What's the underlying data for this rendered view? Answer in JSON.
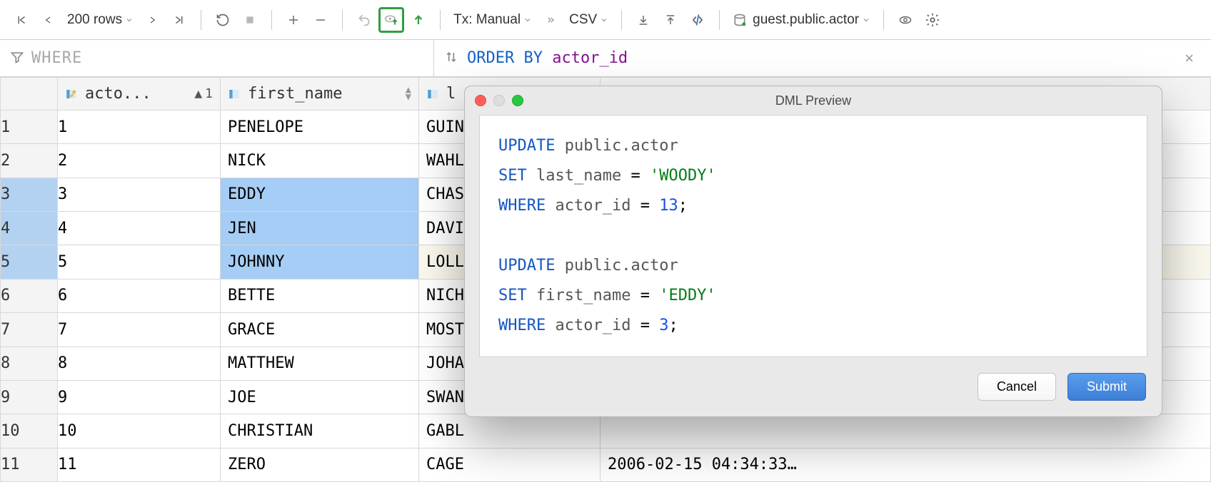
{
  "toolbar": {
    "rows_label": "200 rows",
    "tx_label": "Tx: Manual",
    "csv_label": "CSV",
    "datasource": "guest.public.actor"
  },
  "filters": {
    "where_label": "WHERE",
    "orderby_kw": "ORDER BY",
    "orderby_col": "actor_id"
  },
  "columns": {
    "actor_id": "acto...",
    "first_name": "first_name",
    "last_name": "l",
    "last_update": "",
    "sort_index": "1"
  },
  "rows": [
    {
      "n": "1",
      "actor_id": "1",
      "first_name": "PENELOPE",
      "last_name": "GUIN",
      "last_update": ""
    },
    {
      "n": "2",
      "actor_id": "2",
      "first_name": "NICK",
      "last_name": "WAHL",
      "last_update": ""
    },
    {
      "n": "3",
      "actor_id": "3",
      "first_name": "EDDY",
      "last_name": "CHAS",
      "last_update": ""
    },
    {
      "n": "4",
      "actor_id": "4",
      "first_name": "JEN",
      "last_name": "DAVI",
      "last_update": ""
    },
    {
      "n": "5",
      "actor_id": "5",
      "first_name": "JOHNNY",
      "last_name": "LOLL",
      "last_update": ""
    },
    {
      "n": "6",
      "actor_id": "6",
      "first_name": "BETTE",
      "last_name": "NICH",
      "last_update": ""
    },
    {
      "n": "7",
      "actor_id": "7",
      "first_name": "GRACE",
      "last_name": "MOST",
      "last_update": ""
    },
    {
      "n": "8",
      "actor_id": "8",
      "first_name": "MATTHEW",
      "last_name": "JOHA",
      "last_update": ""
    },
    {
      "n": "9",
      "actor_id": "9",
      "first_name": "JOE",
      "last_name": "SWAN",
      "last_update": ""
    },
    {
      "n": "10",
      "actor_id": "10",
      "first_name": "CHRISTIAN",
      "last_name": "GABL",
      "last_update": ""
    },
    {
      "n": "11",
      "actor_id": "11",
      "first_name": "ZERO",
      "last_name": "CAGE",
      "last_update": "2006-02-15 04:34:33…"
    }
  ],
  "dialog": {
    "title": "DML Preview",
    "cancel": "Cancel",
    "submit": "Submit",
    "sql": {
      "s1": {
        "update": "UPDATE",
        "ns": "public",
        "dot": ".",
        "tbl": "actor",
        "set": "SET",
        "col": "last_name",
        "eq": "=",
        "str": "'WOODY'",
        "where": "WHERE",
        "wcol": "actor_id",
        "weq": "=",
        "num": "13",
        "semi": ";"
      },
      "s2": {
        "update": "UPDATE",
        "ns": "public",
        "dot": ".",
        "tbl": "actor",
        "set": "SET",
        "col": "first_name",
        "eq": "=",
        "str": "'EDDY'",
        "where": "WHERE",
        "wcol": "actor_id",
        "weq": "=",
        "num": "3",
        "semi": ";"
      }
    }
  }
}
